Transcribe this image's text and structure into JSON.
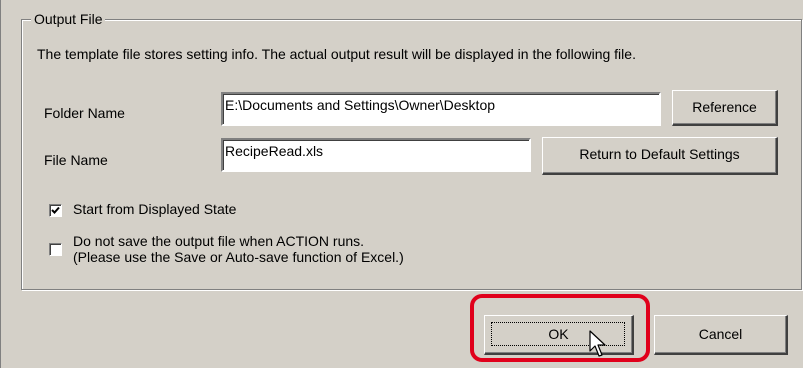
{
  "group": {
    "title": "Output File",
    "description": "The template file stores setting info. The actual output result will be displayed in the following file."
  },
  "folder": {
    "label": "Folder Name",
    "value": "E:\\Documents and Settings\\Owner\\Desktop",
    "button_label": "Reference"
  },
  "file": {
    "label": "File Name",
    "value": "RecipeRead.xls",
    "button_label": "Return to Default Settings"
  },
  "options": {
    "start_from_displayed": {
      "label": "Start from Displayed State",
      "checked": true
    },
    "do_not_save": {
      "label_line1": "Do not save the output file when ACTION runs.",
      "label_line2": "(Please use the Save or Auto-save function of Excel.)",
      "checked": false
    }
  },
  "footer": {
    "ok_label": "OK",
    "cancel_label": "Cancel"
  },
  "colors": {
    "dialog_background": "#d4d0c8",
    "highlight": "#e0001b"
  },
  "icons": {
    "checkmark": "checkmark-icon",
    "cursor": "mouse-pointer-icon"
  }
}
